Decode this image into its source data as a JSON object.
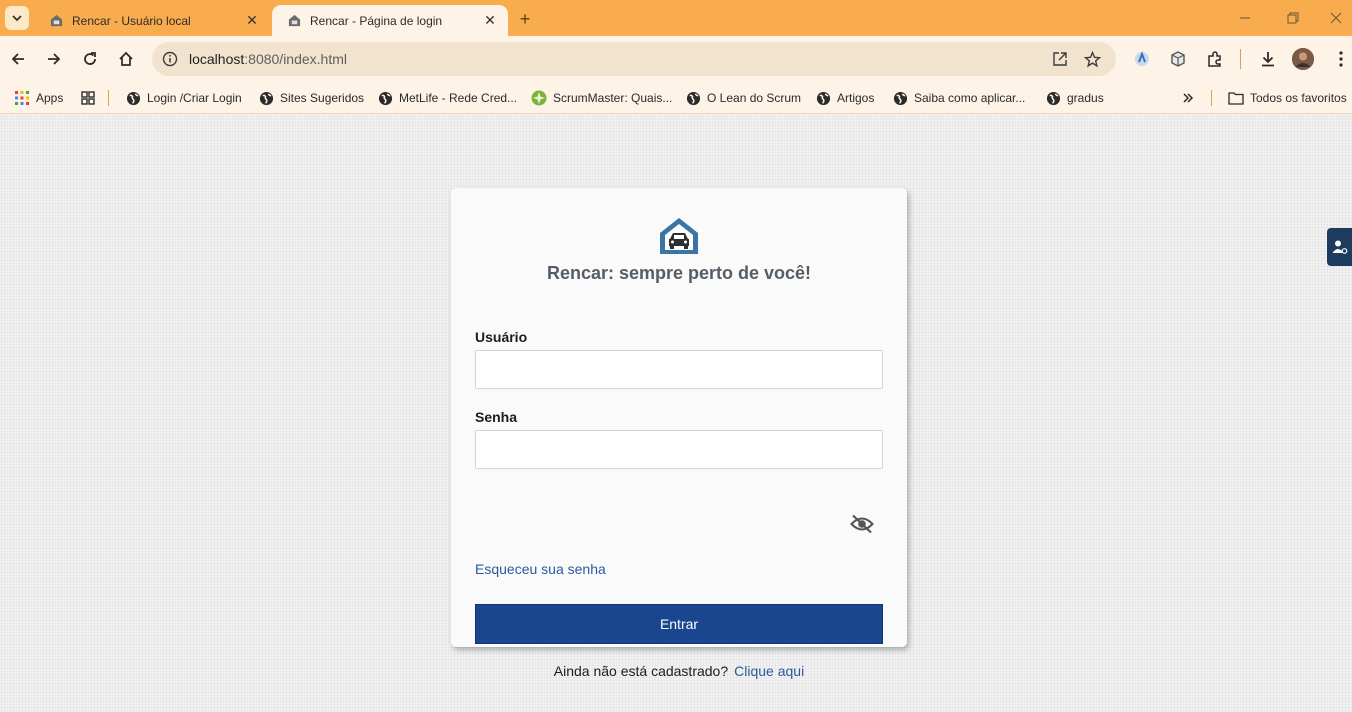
{
  "browser": {
    "tabs": [
      {
        "title": "Rencar - Usuário local",
        "active": false
      },
      {
        "title": "Rencar - Página de login",
        "active": true
      }
    ],
    "url_host": "localhost",
    "url_path": ":8080/index.html",
    "frame_color": "#f9ac4d",
    "bookmarks": [
      {
        "label": "Apps",
        "icon": "apps-grid-icon"
      },
      {
        "label": "Login /Criar Login",
        "icon": "globe-icon"
      },
      {
        "label": "Sites Sugeridos",
        "icon": "globe-icon"
      },
      {
        "label": "MetLife - Rede Cred...",
        "icon": "globe-icon"
      },
      {
        "label": "ScrumMaster: Quais...",
        "icon": "scrum-icon"
      },
      {
        "label": "O Lean do Scrum",
        "icon": "globe-icon"
      },
      {
        "label": "Artigos",
        "icon": "globe-icon"
      },
      {
        "label": "Saiba como aplicar...",
        "icon": "globe-icon"
      },
      {
        "label": "gradus",
        "icon": "globe-icon"
      }
    ],
    "all_bookmarks_label": "Todos os favoritos"
  },
  "login": {
    "slogan": "Rencar: sempre perto de você!",
    "user_label": "Usuário",
    "user_value": "",
    "password_label": "Senha",
    "password_value": "",
    "forgot_label": "Esqueceu sua senha",
    "submit_label": "Entrar",
    "signup_prompt": "Ainda não está cadastrado?",
    "signup_link": "Clique aqui",
    "brand_color": "#1a4690",
    "logo_color": "#3a75a8"
  }
}
